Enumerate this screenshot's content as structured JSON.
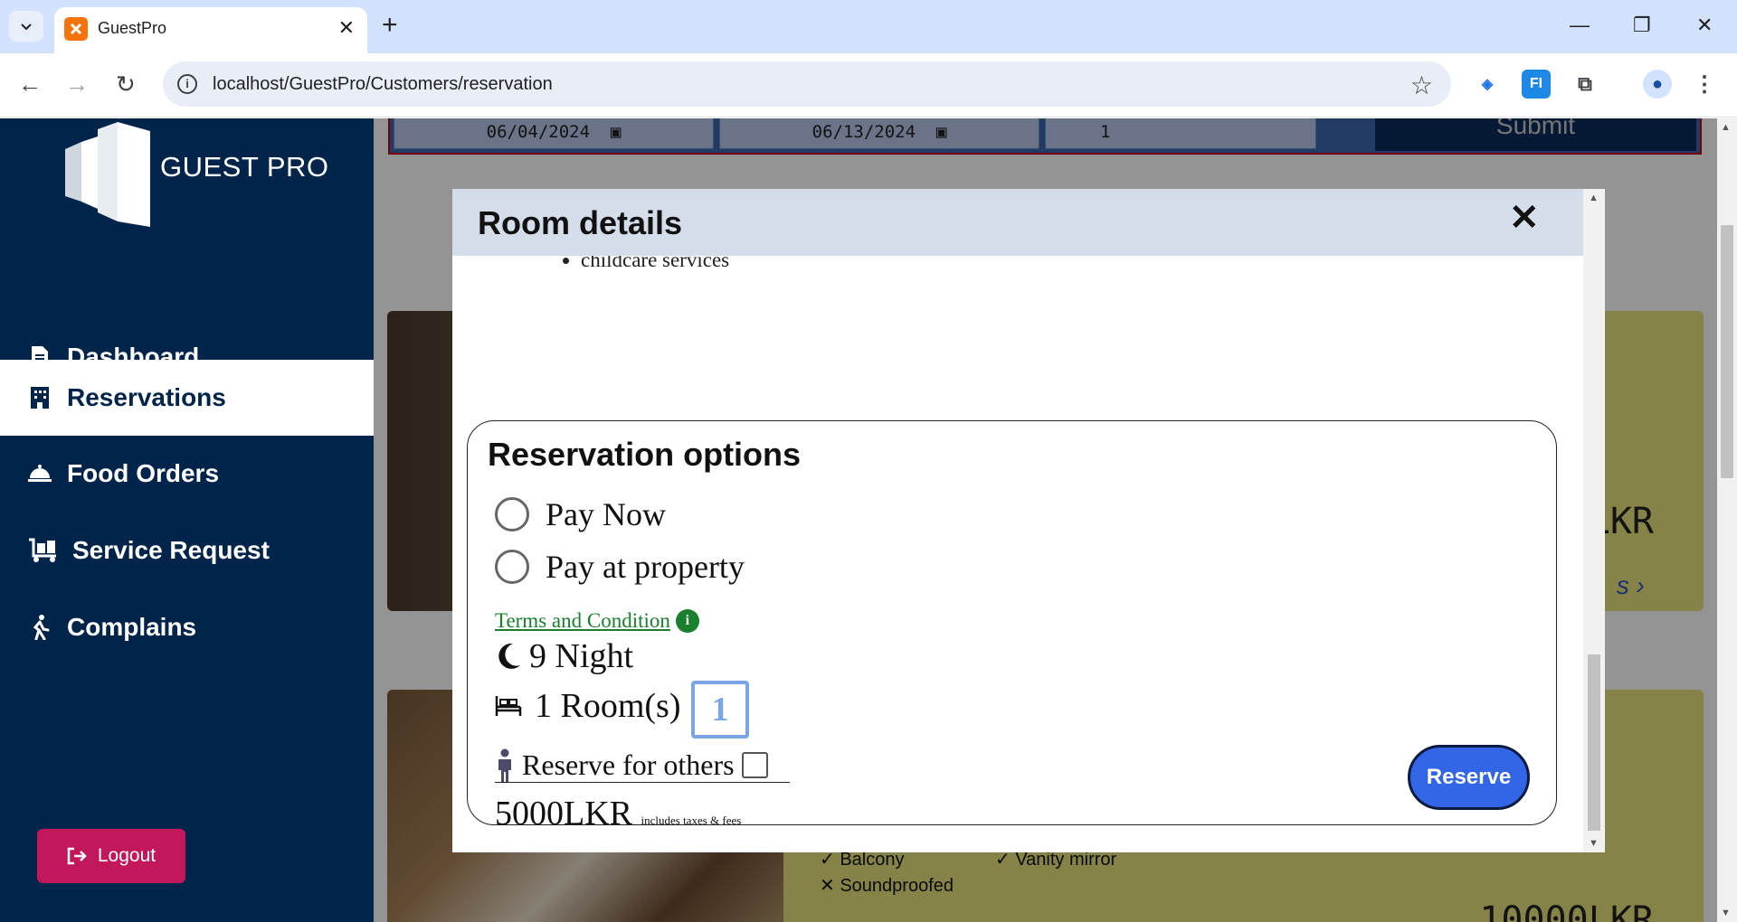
{
  "browser": {
    "tab_title": "GuestPro",
    "new_tab": "+",
    "url": "localhost/GuestPro/Customers/reservation",
    "ext_label": "FI"
  },
  "sidebar": {
    "brand": "GUEST PRO",
    "items": [
      {
        "label": "Dashboard",
        "icon": "document-icon",
        "active": false
      },
      {
        "label": "Reservations",
        "icon": "hotel-icon",
        "active": true
      },
      {
        "label": "Food Orders",
        "icon": "cloche-icon",
        "active": false
      },
      {
        "label": "Service Request",
        "icon": "luggage-cart-icon",
        "active": false
      },
      {
        "label": "Complains",
        "icon": "person-walking-icon",
        "active": false
      }
    ],
    "logout": "Logout"
  },
  "search": {
    "check_in": "06/04/2024",
    "check_out": "06/13/2024",
    "rooms": "1",
    "submit": "Submit"
  },
  "background_cards": [
    {
      "price_fragment": "LKR",
      "link_fragment": "s ›"
    },
    {
      "price": "10000LKR",
      "amenities": [
        "Balcony",
        "Vanity mirror",
        "Soundproofed"
      ]
    }
  ],
  "modal": {
    "title": "Room details",
    "close": "✕",
    "list_items": [
      "childcare services"
    ],
    "options_title": "Reservation options",
    "radio_options": [
      "Pay Now",
      "Pay at property"
    ],
    "terms_label": "Terms and Condition",
    "nights": "9 Night",
    "rooms_label": "1 Room(s)",
    "rooms_value": "1",
    "reserve_for_others": "Reserve for others",
    "price": "5000LKR",
    "price_note": "includes taxes & fees",
    "reserve_button": "Reserve"
  },
  "colors": {
    "sidebar_bg": "#00244a",
    "logout_bg": "#c2185b",
    "reserve_bg": "#3366e6",
    "terms_green": "#1a7f2e",
    "card_bg": "#e6e27a"
  }
}
